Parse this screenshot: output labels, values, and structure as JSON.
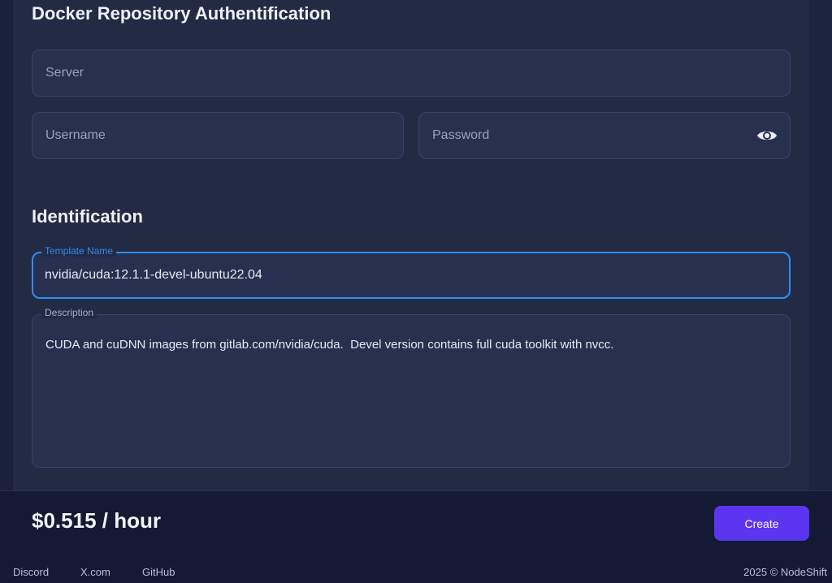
{
  "docker_auth": {
    "title": "Docker Repository Authentification",
    "server_placeholder": "Server",
    "username_placeholder": "Username",
    "password_placeholder": "Password",
    "password_toggle_icon": "eye-icon"
  },
  "identification": {
    "title": "Identification",
    "template_name_label": "Template Name",
    "template_name_value": "nvidia/cuda:12.1.1-devel-ubuntu22.04",
    "description_label": "Description",
    "description_value": "CUDA and cuDNN images from gitlab.com/nvidia/cuda.  Devel version contains full cuda toolkit with nvcc."
  },
  "footer": {
    "price": "$0.515 / hour",
    "create_label": "Create",
    "links": [
      "Discord",
      "X.com",
      "GitHub"
    ],
    "copyright": "2025 © NodeShift"
  },
  "colors": {
    "accent": "#2f8ef5",
    "button": "#5b35f0"
  }
}
